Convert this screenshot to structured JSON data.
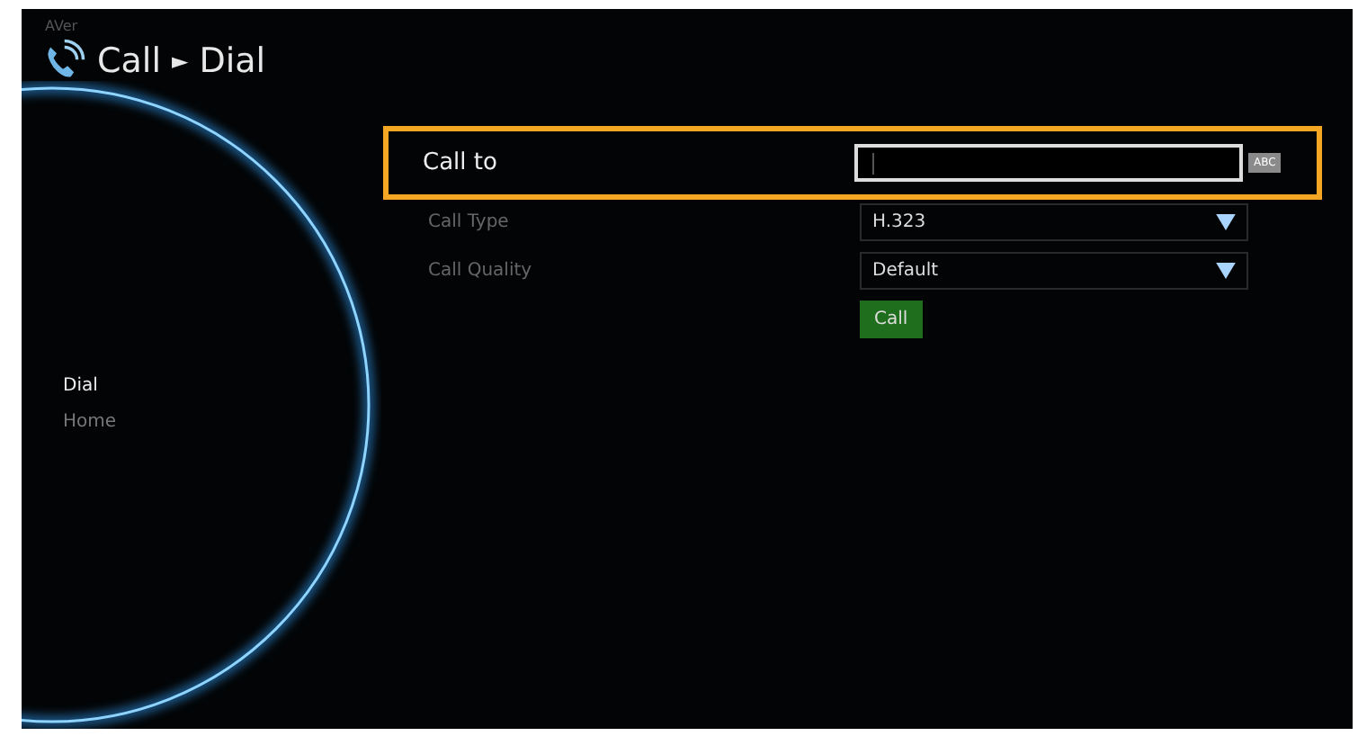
{
  "brand": "AVer",
  "title": {
    "section": "Call",
    "separator": "►",
    "page": "Dial"
  },
  "menu": [
    {
      "label": "Dial",
      "selected": true
    },
    {
      "label": "Home",
      "selected": false
    }
  ],
  "form": [
    {
      "kind": "text",
      "label": "Call to",
      "focused": true,
      "badge": "ABC"
    },
    {
      "kind": "select",
      "label": "Call Type",
      "value": "H.323",
      "focused": false
    },
    {
      "kind": "select",
      "label": "Call Quality",
      "value": "Default",
      "focused": false
    }
  ],
  "button": "Call"
}
